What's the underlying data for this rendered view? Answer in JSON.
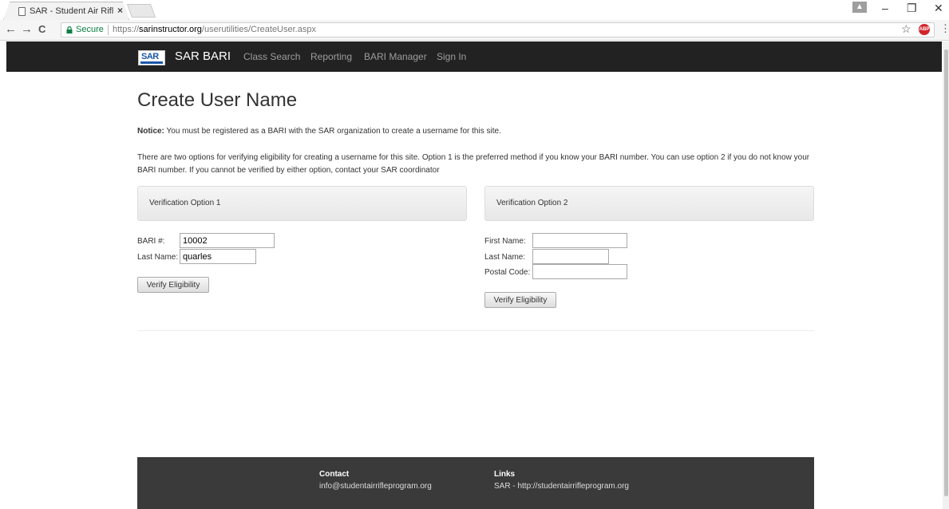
{
  "browser": {
    "tab_title": "SAR - Student Air Riflery",
    "tab_close": "×",
    "secure_label": "Secure",
    "url_scheme": "https://",
    "url_host": "sarinstructor.org",
    "url_path": "/userutilities/CreateUser.aspx",
    "back": "←",
    "forward": "→",
    "reload": "C",
    "star": "☆",
    "abp": "ABP",
    "menu": "⋮",
    "minimize": "–",
    "restore": "❐",
    "close": "✕",
    "profile": "▲"
  },
  "navbar": {
    "brand_logo_text": "SAR",
    "brand": "SAR BARI",
    "links": [
      "Class Search",
      "Reporting",
      "BARI Manager",
      "Sign In"
    ]
  },
  "main": {
    "title": "Create User Name",
    "notice_label": "Notice:",
    "notice_text": "You must be registered as a BARI with the SAR organization to create a username for this site.",
    "options_text": "There are two options for verifying eligibility for creating a username for this site. Option 1 is the preferred method if you know your BARI number. You can use option 2 if you do not know your BARI number. If you cannot be verified by either option, contact your SAR coordinator"
  },
  "option1": {
    "title": "Verification Option 1",
    "bari_label": "BARI #:",
    "bari_value": "10002",
    "last_name_label": "Last Name:",
    "last_name_value": "quarles",
    "button": "Verify Eligibility"
  },
  "option2": {
    "title": "Verification Option 2",
    "first_name_label": "First Name:",
    "first_name_value": "",
    "last_name_label": "Last Name:",
    "last_name_value": "",
    "postal_label": "Postal Code:",
    "postal_value": "",
    "button": "Verify Eligibility"
  },
  "footer": {
    "contact_heading": "Contact",
    "contact_email": "info@studentairrifleprogram.org",
    "links_heading": "Links",
    "links_text": "SAR - http://studentairrifleprogram.org"
  }
}
